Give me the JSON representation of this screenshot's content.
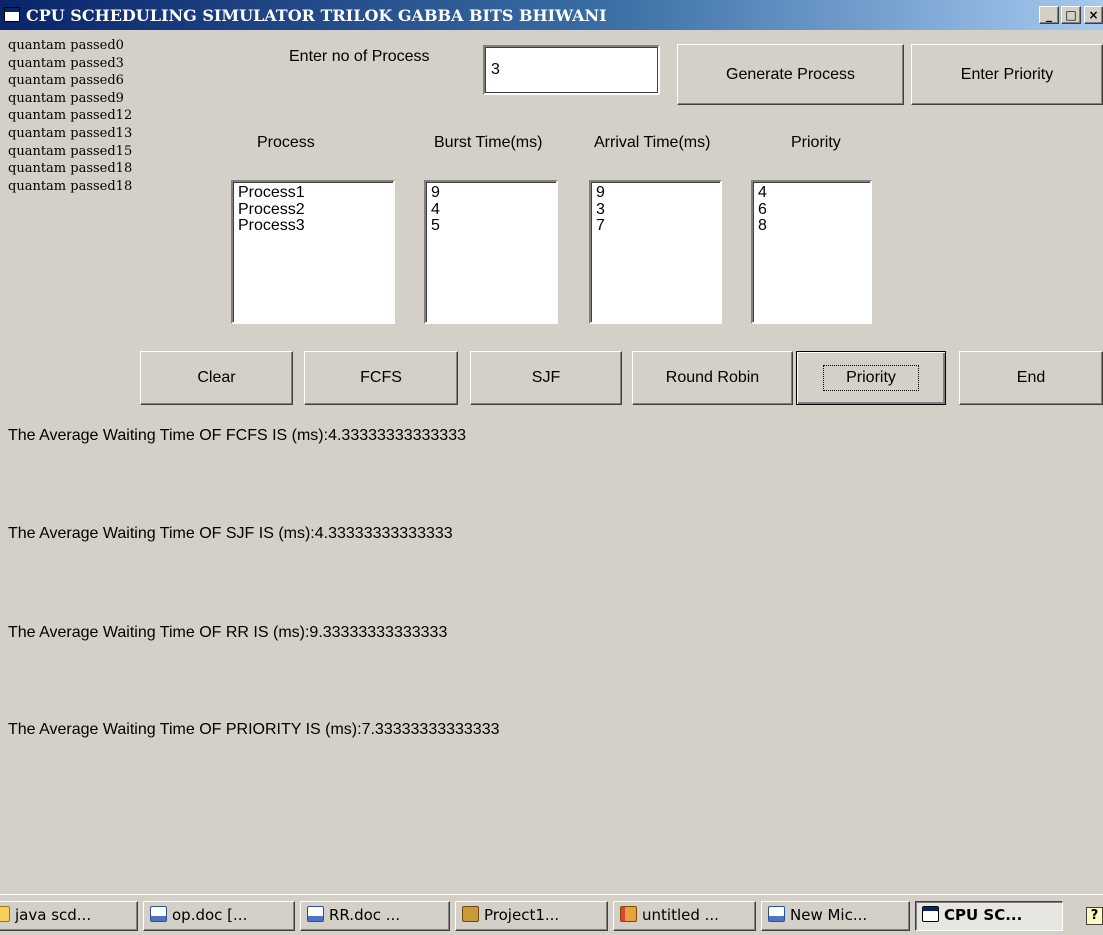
{
  "window": {
    "title": "CPU SCHEDULING SIMULATOR TRILOK GABBA BITS BHIWANI",
    "minimize_glyph": "_",
    "maximize_glyph": "□",
    "close_glyph": "×"
  },
  "quantum_log": [
    "quantam passed0",
    "quantam passed3",
    "quantam passed6",
    "quantam passed9",
    "quantam passed12",
    "quantam passed13",
    "quantam passed15",
    "quantam passed18",
    "quantam passed18"
  ],
  "input": {
    "label": "Enter no of Process",
    "value": "3"
  },
  "buttons": {
    "generate": "Generate Process",
    "enter_priority": "Enter Priority",
    "clear": "Clear",
    "fcfs": "FCFS",
    "sjf": "SJF",
    "round_robin": "Round Robin",
    "priority": "Priority",
    "end": "End"
  },
  "columns": {
    "process": "Process",
    "burst": "Burst Time(ms)",
    "arrival": "Arrival Time(ms)",
    "priority": "Priority"
  },
  "lists": {
    "process": [
      "Process1",
      "Process2",
      "Process3"
    ],
    "burst": [
      "9",
      "4",
      "5"
    ],
    "arrival": [
      "9",
      "3",
      "7"
    ],
    "priority": [
      "4",
      "6",
      "8"
    ]
  },
  "results": {
    "fcfs": "The Average Waiting Time OF FCFS IS (ms):4.33333333333333",
    "sjf": "The Average Waiting Time OF SJF IS (ms):4.33333333333333",
    "rr": "The Average Waiting Time OF RR IS (ms):9.33333333333333",
    "priority": "The Average Waiting Time OF PRIORITY IS (ms):7.33333333333333"
  },
  "taskbar": {
    "items": [
      {
        "label": "java scd...",
        "icon": "folder-icon"
      },
      {
        "label": "op.doc [...",
        "icon": "word-doc-icon"
      },
      {
        "label": "RR.doc ...",
        "icon": "word-doc-icon"
      },
      {
        "label": "Project1...",
        "icon": "vb-project-icon"
      },
      {
        "label": "untitled ...",
        "icon": "paint-icon"
      },
      {
        "label": "New Mic...",
        "icon": "word-doc-icon"
      },
      {
        "label": "CPU SC...",
        "icon": "window-icon"
      }
    ],
    "help_glyph": "?"
  }
}
